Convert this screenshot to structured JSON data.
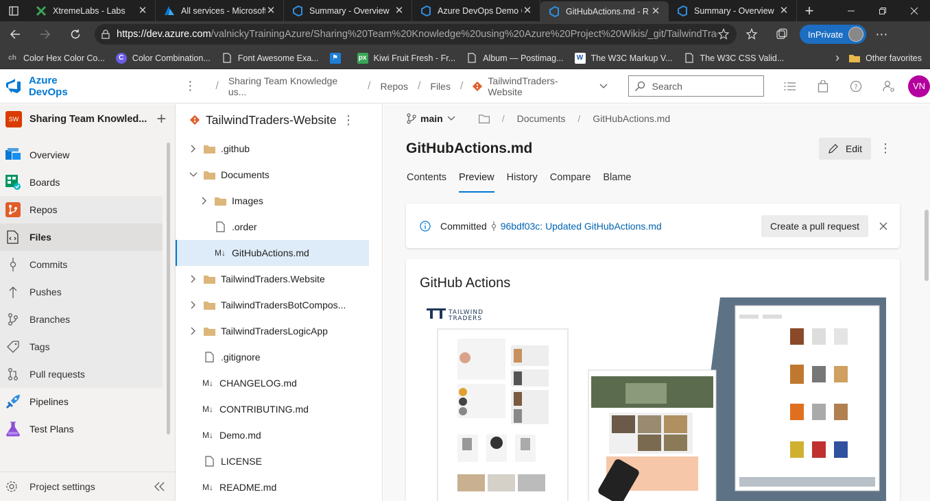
{
  "browser": {
    "tabs": [
      {
        "title": "XtremeLabs - Labs",
        "active": false
      },
      {
        "title": "All services - Microsoft",
        "active": false
      },
      {
        "title": "Summary - Overview",
        "active": false
      },
      {
        "title": "Azure DevOps Demo G",
        "active": false
      },
      {
        "title": "GitHubActions.md - R",
        "active": true
      },
      {
        "title": "Summary - Overview",
        "active": false
      }
    ],
    "url_host": "https://dev.azure.com",
    "url_path": "/valnickyTrainingAzure/Sharing%20Team%20Knowledge%20using%20Azure%20Project%20Wikis/_git/TailwindTraders-...",
    "inprivate_label": "InPrivate",
    "favorites": [
      {
        "label": "Color Hex Color Co..."
      },
      {
        "label": "Color Combination..."
      },
      {
        "label": "Font Awesome Exa..."
      },
      {
        "label": "Kiwi Fruit Fresh - Fr..."
      },
      {
        "label": "Album — Postimag..."
      },
      {
        "label": "The W3C Markup V..."
      },
      {
        "label": "The W3C CSS Valid..."
      }
    ],
    "other_favorites": "Other favorites"
  },
  "header": {
    "brand": "Azure DevOps",
    "breadcrumb": [
      "Sharing Team Knowledge us...",
      "Repos",
      "Files",
      "TailwindTraders-Website"
    ],
    "search_placeholder": "Search",
    "avatar_initials": "VN"
  },
  "sidebar": {
    "project_badge": "SW",
    "project_name": "Sharing Team Knowled...",
    "items": [
      {
        "label": "Overview"
      },
      {
        "label": "Boards"
      },
      {
        "label": "Repos"
      },
      {
        "label": "Files"
      },
      {
        "label": "Commits"
      },
      {
        "label": "Pushes"
      },
      {
        "label": "Branches"
      },
      {
        "label": "Tags"
      },
      {
        "label": "Pull requests"
      },
      {
        "label": "Pipelines"
      },
      {
        "label": "Test Plans"
      }
    ],
    "footer_label": "Project settings"
  },
  "filetree": {
    "repo_name": "TailwindTraders-Website",
    "rows": [
      {
        "label": ".github"
      },
      {
        "label": "Documents"
      },
      {
        "label": "Images"
      },
      {
        "label": ".order"
      },
      {
        "label": "GitHubActions.md"
      },
      {
        "label": "TailwindTraders.Website"
      },
      {
        "label": "TailwindTradersBotCompos..."
      },
      {
        "label": "TailwindTradersLogicApp"
      },
      {
        "label": ".gitignore"
      },
      {
        "label": "CHANGELOG.md"
      },
      {
        "label": "CONTRIBUTING.md"
      },
      {
        "label": "Demo.md"
      },
      {
        "label": "LICENSE"
      },
      {
        "label": "README.md"
      }
    ]
  },
  "content": {
    "branch": "main",
    "path": [
      "Documents",
      "GitHubActions.md"
    ],
    "file_name": "GitHubActions.md",
    "edit_label": "Edit",
    "tabs": [
      "Contents",
      "Preview",
      "History",
      "Compare",
      "Blame"
    ],
    "active_tab": "Preview",
    "commit_label": "Committed",
    "commit_link": "96bdf03c: Updated GitHubActions.md",
    "pr_button": "Create a pull request",
    "preview_heading": "GitHub Actions",
    "logo_text": [
      "TAILWIND",
      "TRADERS"
    ]
  },
  "colors": {
    "accent": "#0078d4",
    "avatar_bg": "#b4009e",
    "project_badge_bg": "#da3b01",
    "git_icon": "#e05d2a",
    "folder": "#dcb67a"
  }
}
